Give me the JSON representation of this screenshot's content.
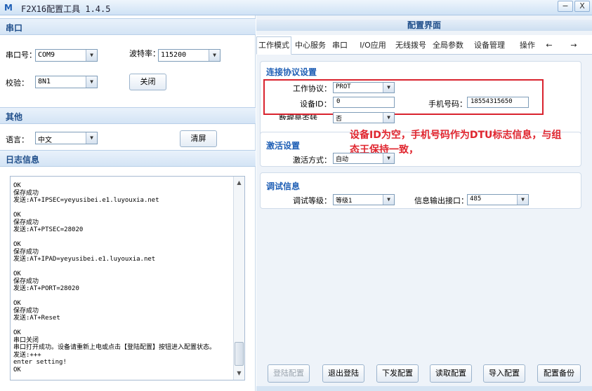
{
  "window": {
    "title": "F2X16配置工具 1.4.5",
    "app_icon": "M",
    "min": "−",
    "close": "X"
  },
  "left": {
    "serial": {
      "header": "串口",
      "port_label": "串口号：",
      "port_value": "COM9",
      "baud_label": "波特率：",
      "baud_value": "115200",
      "parity_label": "校验：",
      "parity_value": "8N1",
      "close_btn": "关闭"
    },
    "other": {
      "header": "其他",
      "lang_label": "语言：",
      "lang_value": "中文",
      "clear_btn": "清屏"
    },
    "log": {
      "header": "日志信息",
      "text": "OK\n保存成功\n发送:AT+IPSEC=yeyusibei.e1.luyouxia.net\n\nOK\n保存成功\n发送:AT+PTSEC=28020\n\nOK\n保存成功\n发送:AT+IPAD=yeyusibei.e1.luyouxia.net\n\nOK\n保存成功\n发送:AT+PORT=28020\n\nOK\n保存成功\n发送:AT+Reset\n\nOK\n串口关闭\n串口打开成功。设备请重新上电或点击【登陆配置】按钮进入配置状态。\n发送:+++\nenter setting!\nOK"
    }
  },
  "right": {
    "header": "配置界面",
    "tabs": [
      "工作模式",
      "中心服务",
      "串口",
      "I/O应用",
      "无线拨号",
      "全局参数",
      "设备管理",
      "操作",
      "←",
      "→"
    ],
    "conn": {
      "title": "连接协议设置",
      "protocol_label": "工作协议：",
      "protocol_value": "PROT",
      "device_id_label": "设备ID：",
      "device_id_value": "0",
      "phone_label": "手机号码：",
      "phone_value": "18554315650",
      "transfer_label": "数据是否转义：",
      "transfer_value": "否"
    },
    "activate": {
      "title": "激活设置",
      "mode_label": "激活方式：",
      "mode_value": "自动"
    },
    "debug": {
      "title": "调试信息",
      "level_label": "调试等级：",
      "level_value": "等级1",
      "port_label": "信息输出接口：",
      "port_value": "485"
    },
    "annotation": "设备ID为空，手机号码作为DTU标志信息，与组态王保持一致，",
    "buttons": [
      "登陆配置",
      "退出登陆",
      "下发配置",
      "读取配置",
      "导入配置",
      "配置备份"
    ]
  },
  "colors": {
    "header_text": "#1f4e8a",
    "group_title": "#1f5fb5",
    "annotation": "#e0262f",
    "highlight_box": "#d9232e"
  }
}
